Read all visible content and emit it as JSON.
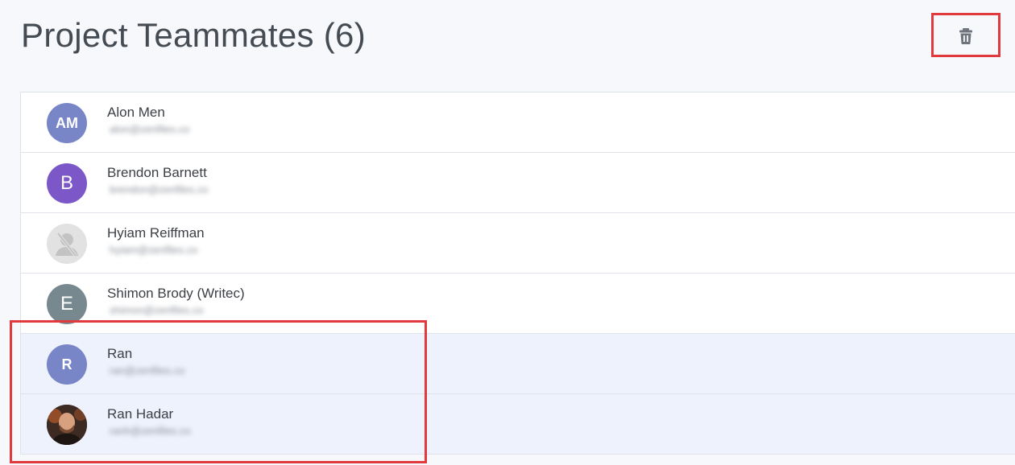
{
  "header": {
    "title": "Project Teammates (6)"
  },
  "toolbar": {
    "delete_icon": "trash-icon",
    "accent_color": "#e0393e"
  },
  "teammates": [
    {
      "name": "Alon Men",
      "email": "alon@zenfiles.co",
      "initials": "AM",
      "color": "#7886c7",
      "selected": false
    },
    {
      "name": "Brendon Barnett",
      "email": "brendon@zenfiles.co",
      "initials": "B",
      "color": "#7c57c8",
      "selected": false
    },
    {
      "name": "Hyiam Reiffman",
      "email": "hyiam@zenfiles.co",
      "initials": "",
      "color": "#e2e2e2",
      "selected": false
    },
    {
      "name": "Shimon Brody (Writec)",
      "email": "shimon@zenfiles.co",
      "initials": "E",
      "color": "#77898f",
      "selected": false
    },
    {
      "name": "Ran",
      "email": "ran@zenfiles.co",
      "initials": "R",
      "color": "#7886c7",
      "selected": true
    },
    {
      "name": "Ran Hadar",
      "email": "ranh@zenfiles.co",
      "initials": "",
      "color": "#5a3a2c",
      "selected": true
    }
  ]
}
